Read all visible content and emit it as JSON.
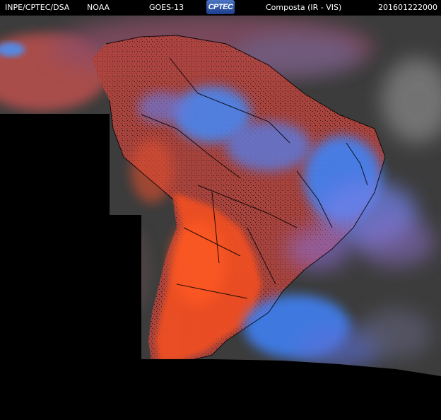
{
  "header": {
    "agency": "INPE/CPTEC/DSA",
    "source": "NOAA",
    "satellite": "GOES-13",
    "logo_text": "CPTEC",
    "product": "Composta (IR - VIS)",
    "timestamp": "201601222000"
  },
  "colors": {
    "background": "#000000",
    "cold_cloud_blue": "#3f7ff0",
    "violet_cloud": "#8a6fd8",
    "warm_surface_orange": "#f0502a",
    "surface_red": "#c24a48",
    "ocean_gray": "#3c3c3c",
    "borders": "#000000"
  }
}
